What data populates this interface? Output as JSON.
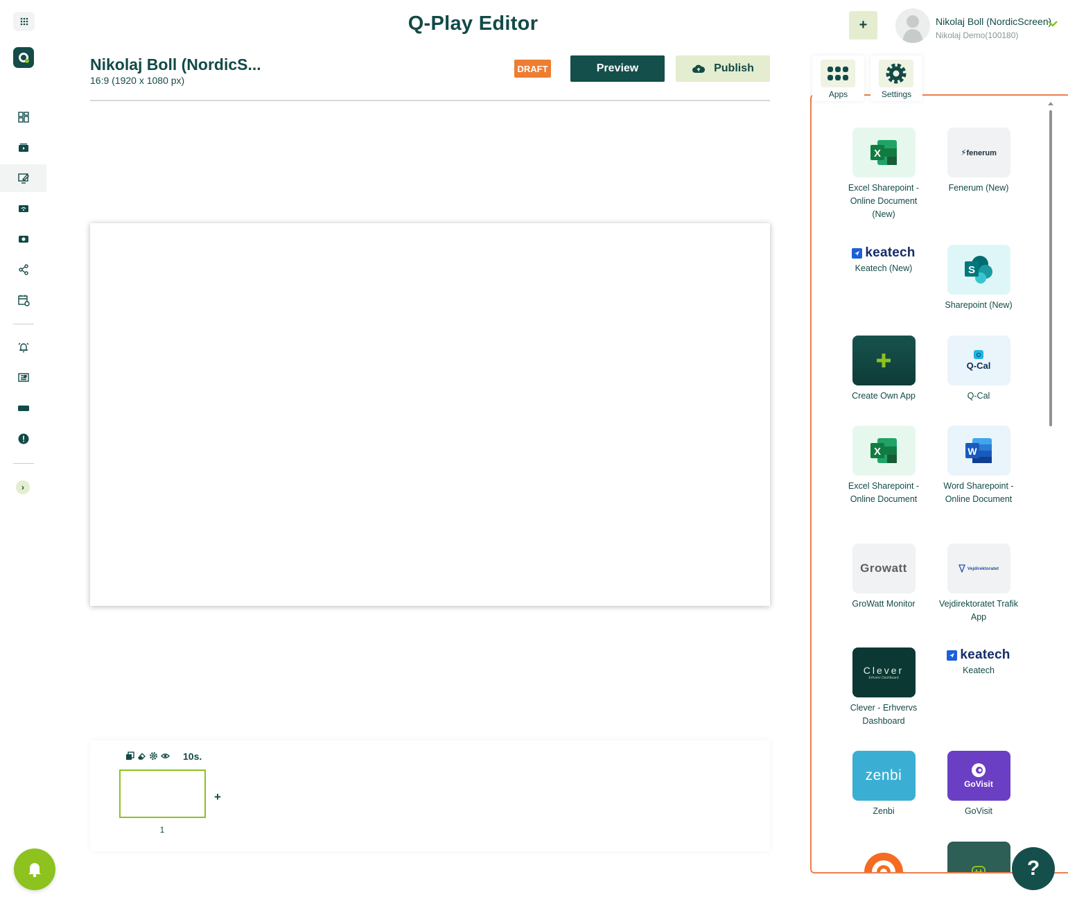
{
  "header": {
    "title": "Q-Play Editor",
    "add_label": "+",
    "user": {
      "name": "Nikolaj Boll (NordicScreen)",
      "org": "Nikolaj Demo(100180)"
    }
  },
  "document": {
    "title": "Nikolaj Boll (NordicS...",
    "size": "16:9 (1920 x 1080 px)",
    "status": "DRAFT",
    "preview_label": "Preview",
    "publish_label": "Publish"
  },
  "slides": {
    "duration": "10s.",
    "items": [
      {
        "number": "1"
      }
    ],
    "add_label": "+"
  },
  "panel": {
    "tabs": [
      {
        "label": "Apps"
      },
      {
        "label": "Settings"
      }
    ],
    "apps": [
      {
        "label": "Excel Sharepoint - Online Document (New)",
        "icon": "excel-icon"
      },
      {
        "label": "Fenerum (New)",
        "icon": "fenerum-logo",
        "logo_text": "fenerum"
      },
      {
        "label": "Keatech (New)",
        "icon": "keatech-logo",
        "logo_text": "keatech"
      },
      {
        "label": "Sharepoint (New)",
        "icon": "sharepoint-icon"
      },
      {
        "label": "Create Own App",
        "icon": "plus-icon"
      },
      {
        "label": "Q-Cal",
        "icon": "qcal-logo",
        "logo_text": "Q-Cal"
      },
      {
        "label": "Excel Sharepoint - Online Document",
        "icon": "excel-icon"
      },
      {
        "label": "Word Sharepoint - Online Document",
        "icon": "word-icon"
      },
      {
        "label": "GroWatt Monitor",
        "icon": "growatt-logo",
        "logo_text": "Growatt"
      },
      {
        "label": "Vejdirektoratet Trafik App",
        "icon": "vejdirektoratet-logo",
        "logo_text": "Vejdirektoratet"
      },
      {
        "label": "Clever - Erhvervs Dashboard",
        "icon": "clever-logo",
        "logo_text": "Clever",
        "logo_subtext": "Erhverv Dashboard"
      },
      {
        "label": "Keatech",
        "icon": "keatech-logo",
        "logo_text": "keatech"
      },
      {
        "label": "Zenbi",
        "icon": "zenbi-logo",
        "logo_text": "zenbi"
      },
      {
        "label": "GoVisit",
        "icon": "govisit-logo",
        "logo_text": "GoVisit"
      }
    ]
  },
  "help_label": "?",
  "colors": {
    "primary": "#124a47",
    "accent": "#8dc21f",
    "draft": "#ee7d32",
    "light_green": "#e4edcf",
    "panel_border": "#ee7d4a"
  }
}
